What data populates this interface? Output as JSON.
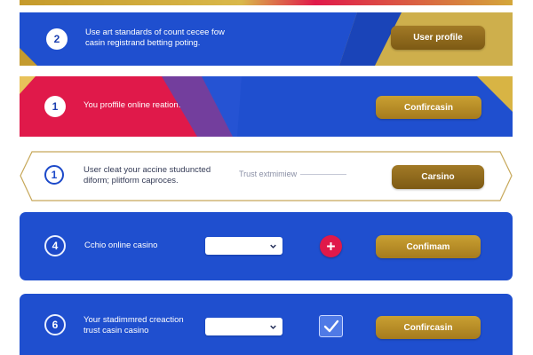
{
  "cards": [
    {
      "number": "2",
      "text": "Use art standards of count cecee fow\ncasin registrand betting poting.",
      "button": "User profile"
    },
    {
      "number": "1",
      "text": "You proffile online reation.",
      "button": "Confircasin"
    },
    {
      "number": "1",
      "text": "User cleat your accine studuncted\ndiform; plitform caproces.",
      "link": "Trust extmimiew",
      "button": "Carsino"
    },
    {
      "number": "4",
      "text": "Cchio online casino",
      "button": "Confimam"
    },
    {
      "number": "6",
      "text": "Your stadimmred creaction\ntrust casin casino",
      "button": "Confircasin"
    }
  ],
  "colors": {
    "blue": "#1f4fcf",
    "gold": "#c9a032",
    "red": "#e0194a"
  },
  "icons": {
    "plus": "plus-icon",
    "check": "checkmark-icon",
    "chevron": "chevron-down-icon"
  }
}
